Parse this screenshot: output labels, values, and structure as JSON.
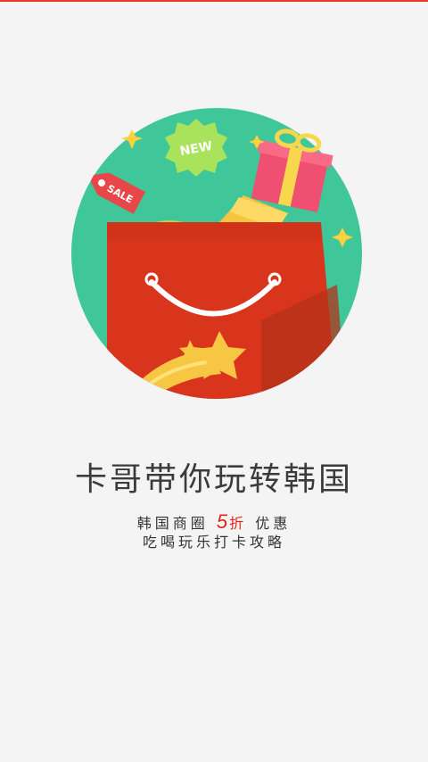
{
  "colors": {
    "background": "#f4f4f4",
    "top_accent": "#e83828",
    "circle": "#3fc79a",
    "bag": "#d9351c",
    "title_text": "#3b3b3b",
    "highlight": "#e2231a"
  },
  "hero": {
    "sale_tag_text": "SALE",
    "new_badge_text": "NEW",
    "icons": [
      "sale-tag-icon",
      "new-badge-icon",
      "gift-box-icon",
      "shopping-bag-icon",
      "shooting-star-icon",
      "sparkle-icon"
    ]
  },
  "title": "卡哥带你玩转韩国",
  "subtitle_line1": {
    "before": "韩国商圈",
    "number": "5",
    "unit": "折",
    "after": "优惠"
  },
  "subtitle_line2": "吃喝玩乐打卡攻略"
}
